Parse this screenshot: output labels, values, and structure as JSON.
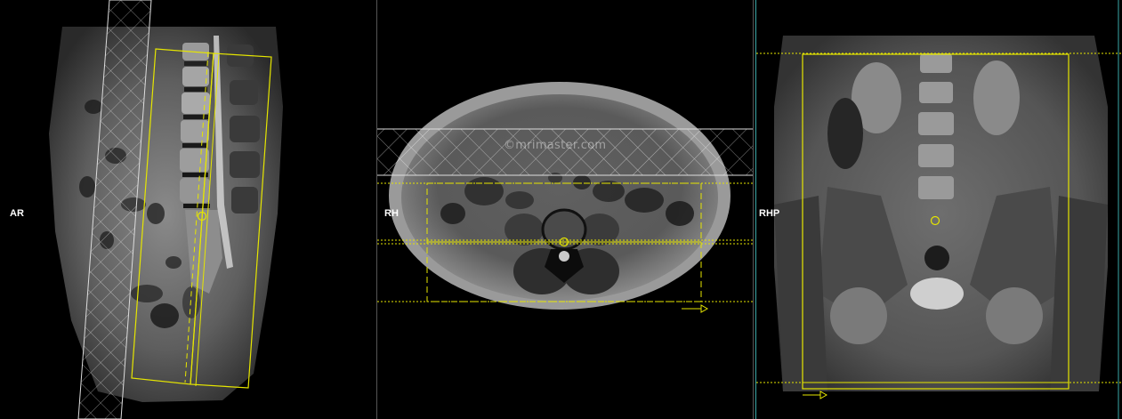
{
  "viewports": {
    "sagittal": {
      "orientation_label": "AR"
    },
    "axial": {
      "orientation_label": "RH",
      "watermark": "©mrimaster.com"
    },
    "coronal": {
      "orientation_label": "RHP"
    }
  },
  "colors": {
    "planning_box": "#e6e600",
    "saturation_band": "#ffffff",
    "viewport_divider_gray": "#555555",
    "viewport_divider_teal": "#3aa7a7",
    "background": "#000000"
  }
}
